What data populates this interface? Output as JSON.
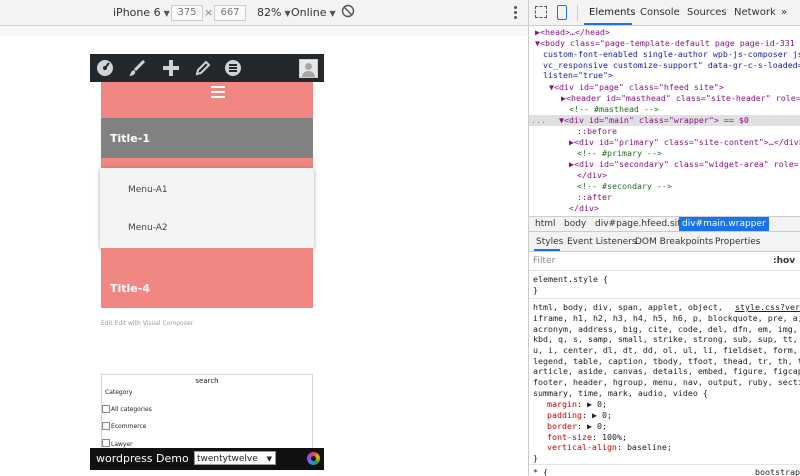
{
  "device_toolbar": {
    "device": "iPhone 6",
    "width": "375",
    "times": "×",
    "height": "667",
    "zoom": "82%",
    "network": "Online"
  },
  "page": {
    "menu_items": [
      {
        "label": "Title-1"
      },
      {
        "label": "Menu-A1"
      },
      {
        "label": "Menu-A2"
      },
      {
        "label": "Title-4"
      }
    ],
    "edit_link": "Edit Edit with Visual Composer",
    "search_widget": {
      "title": "search",
      "category_label": "Category",
      "options": [
        "All categories",
        "Ecommerce",
        "Lawyer"
      ]
    },
    "footer": {
      "brand": "wordpress Demo",
      "theme_select": "twentytwelve"
    }
  },
  "devtools": {
    "tabs": [
      "Elements",
      "Console",
      "Sources",
      "Network",
      "»"
    ],
    "dom_lines": [
      "▶<head>…</head>",
      "▼<body class=\"page-template-default page page-id-331",
      "custom-font-enabled single-author wpb-js-composer js",
      "vc_responsive customize-support\" data-gr-c-s-loaded=",
      "listen=\"true\">",
      "▼<div id=\"page\" class=\"hfeed site\">",
      "▶<header id=\"masthead\" class=\"site-header\" role=",
      "<!-- #masthead -->",
      "▼<div id=\"main\" class=\"wrapper\"> == $0",
      "::before",
      "▶<div id=\"primary\" class=\"site-content\">…</div>",
      "<!-- #primary -->",
      "▶<div id=\"secondary\" class=\"widget-area\" role=",
      "</div>",
      "<!-- #secondary -->",
      "::after",
      "</div>"
    ],
    "dom_gutter": "...",
    "breadcrumbs": [
      "html",
      "body",
      "div#page.hfeed.site",
      "div#main.wrapper"
    ],
    "style_tabs": [
      "Styles",
      "Event Listeners",
      "DOM Breakpoints",
      "Properties"
    ],
    "filter_placeholder": "Filter",
    "hov": ":hov",
    "element_style": [
      "element.style {",
      "}"
    ],
    "rule_source": "style.css?ver",
    "rule_selector_lines": [
      "html, body, div, span, applet, object,",
      "iframe, h1, h2, h3, h4, h5, h6, p, blockquote, pre, a,",
      "acronym, address, big, cite, code, del, dfn, em, img,",
      "kbd, q, s, samp, small, strike, strong, sub, sup, tt,",
      "u, i, center, dl, dt, dd, ol, ul, li, fieldset, form,",
      "legend, table, caption, tbody, tfoot, thead, tr, th, t",
      "article, aside, canvas, details, embed, figure, figcap",
      "footer, header, hgroup, menu, nav, output, ruby, secti",
      "summary, time, mark, audio, video {"
    ],
    "rule_props": [
      {
        "name": "margin",
        "value": "▶ 0;"
      },
      {
        "name": "padding",
        "value": "▶ 0;"
      },
      {
        "name": "border",
        "value": "▶ 0;"
      },
      {
        "name": "font-size",
        "value": "100%;"
      },
      {
        "name": "vertical-align",
        "value": "baseline;"
      }
    ],
    "rule_close": "}",
    "next_rule": "* {",
    "next_source": "bootstrap"
  }
}
